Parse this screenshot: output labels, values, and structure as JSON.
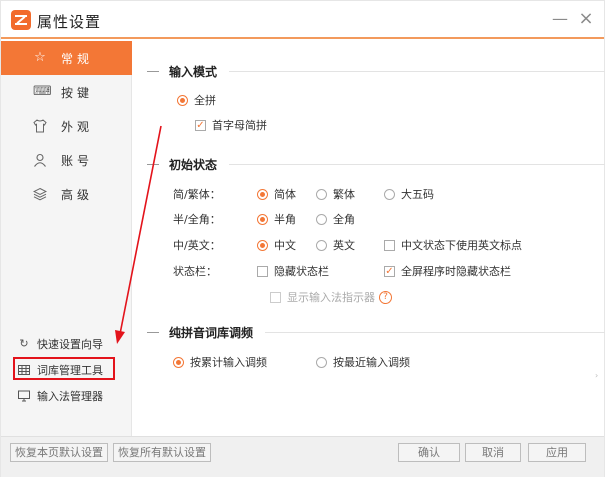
{
  "window": {
    "title": "属性设置",
    "minimize_glyph": "—",
    "close_glyph": "×"
  },
  "sidebar": {
    "items": [
      {
        "label": "常规",
        "icon": "star-icon",
        "active": true
      },
      {
        "label": "按键",
        "icon": "keyboard-icon",
        "active": false
      },
      {
        "label": "外观",
        "icon": "shirt-icon",
        "active": false
      },
      {
        "label": "账号",
        "icon": "user-icon",
        "active": false
      },
      {
        "label": "高级",
        "icon": "layers-icon",
        "active": false
      }
    ],
    "tools": [
      {
        "label": "快速设置向导",
        "icon": "refresh-icon"
      },
      {
        "label": "词库管理工具",
        "icon": "grid-icon",
        "highlighted": true
      },
      {
        "label": "输入法管理器",
        "icon": "monitor-icon"
      }
    ]
  },
  "sections": {
    "input_mode": {
      "title": "输入模式",
      "full_pinyin": "全拼",
      "initial_abbrev": "首字母简拼"
    },
    "initial_state": {
      "title": "初始状态",
      "rows": {
        "script": {
          "label": "简/繁体：",
          "options": [
            "简体",
            "繁体",
            "大五码"
          ]
        },
        "width": {
          "label": "半/全角：",
          "options": [
            "半角",
            "全角"
          ]
        },
        "lang": {
          "label": "中/英文：",
          "options": [
            "中文",
            "英文"
          ],
          "extra": "中文状态下使用英文标点"
        },
        "statusbar": {
          "label": "状态栏：",
          "hide": "隐藏状态栏",
          "fullscreen_hide": "全屏程序时隐藏状态栏"
        },
        "indicator": "显示输入法指示器",
        "help_glyph": "?"
      }
    },
    "pinyin_tuning": {
      "title": "纯拼音词库调频",
      "options": [
        "按累计输入调频",
        "按最近输入调频"
      ]
    }
  },
  "footer": {
    "restore_page": "恢复本页默认设置",
    "restore_all": "恢复所有默认设置",
    "ok": "确认",
    "cancel": "取消",
    "apply": "应用"
  },
  "colors": {
    "accent": "#f37736",
    "annotation": "#e3131b"
  }
}
